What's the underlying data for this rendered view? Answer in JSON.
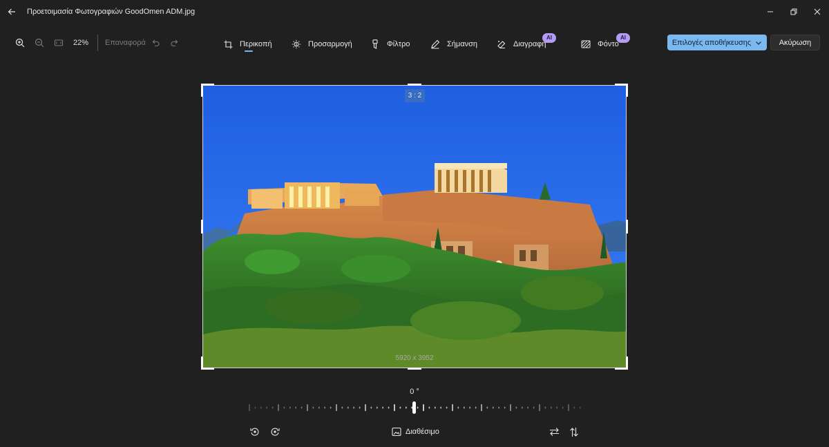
{
  "window": {
    "title": "Προετοιμασία Φωτογραφιών GoodOmen ADM.jpg"
  },
  "toolbar": {
    "zoom_level": "22%",
    "reset_label": "Επαναφορά",
    "tabs": [
      {
        "label": "Περικοπή",
        "icon": "crop-icon",
        "active": true
      },
      {
        "label": "Προσαρμογή",
        "icon": "brightness-icon",
        "active": false
      },
      {
        "label": "Φίλτρο",
        "icon": "filter-icon",
        "active": false
      },
      {
        "label": "Σήμανση",
        "icon": "markup-pen-icon",
        "active": false
      },
      {
        "label": "Διαγραφή",
        "icon": "erase-icon",
        "active": false,
        "badge": "AI"
      },
      {
        "label": "Φόντο",
        "icon": "background-icon",
        "active": false,
        "badge": "AI"
      }
    ],
    "save_label": "Επιλογές αποθήκευσης",
    "cancel_label": "Ακύρωση"
  },
  "canvas": {
    "aspect_ratio": "3 : 2",
    "dimensions": "5920 x 3952"
  },
  "rotation": {
    "angle": "0 °"
  },
  "bottom": {
    "free_label": "Διαθέσιμο"
  },
  "colors": {
    "accent": "#7cb8f0",
    "ai_badge": "#b29cf5",
    "background": "#202020"
  }
}
